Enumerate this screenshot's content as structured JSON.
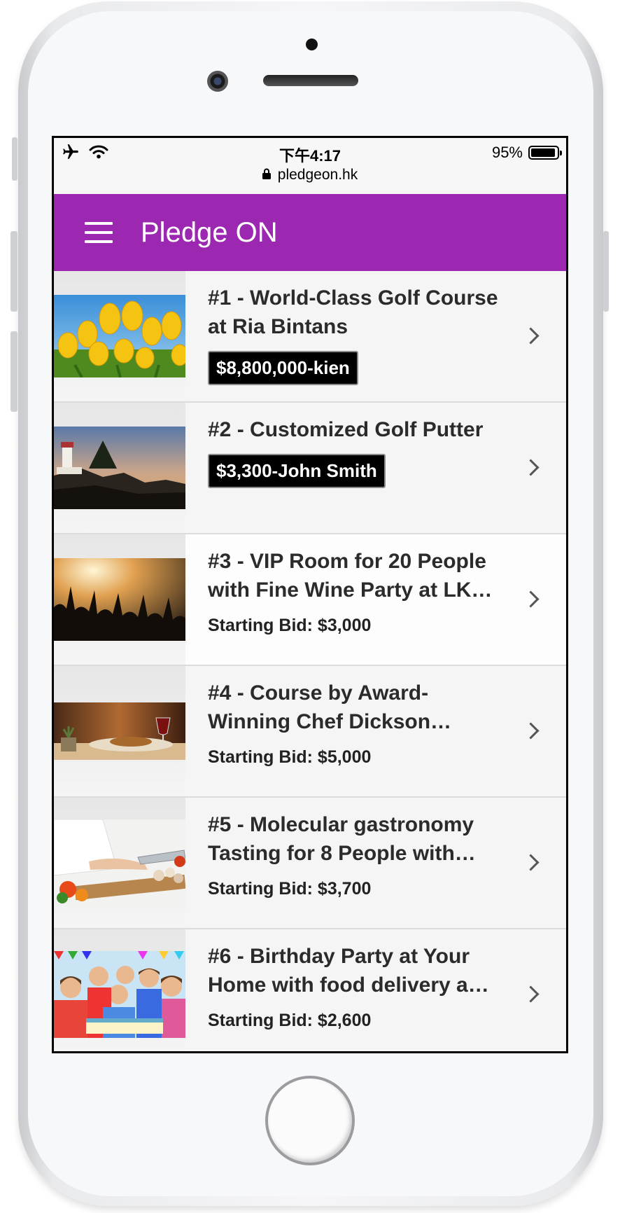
{
  "status": {
    "time": "下午4:17",
    "url": "pledgeon.hk",
    "battery_text": "95%",
    "battery_level": 0.95
  },
  "app": {
    "title": "Pledge ON",
    "accent": "#9c27b0"
  },
  "items": [
    {
      "title": "#1 - World-Class Golf Course at Ria Bintans",
      "bid": "$8,800,000-kien",
      "bid_type": "badge"
    },
    {
      "title": "#2 - Customized Golf Putter",
      "bid": "$3,300-John Smith",
      "bid_type": "badge"
    },
    {
      "title": "#3 - VIP Room for 20 People with Fine Wine Party at LK…",
      "bid": "Starting Bid: $3,000",
      "bid_type": "text"
    },
    {
      "title": "#4 - Course by Award-Winning Chef Dickson…",
      "bid": "Starting Bid: $5,000",
      "bid_type": "text"
    },
    {
      "title": "#5 - Molecular gastronomy Tasting for 8 People with…",
      "bid": "Starting Bid: $3,700",
      "bid_type": "text"
    },
    {
      "title": "#6 - Birthday Party at Your Home with food delivery a…",
      "bid": "Starting Bid: $2,600",
      "bid_type": "text"
    }
  ],
  "icons": {
    "airplane": "airplane-icon",
    "wifi": "wifi-icon",
    "lock": "lock-icon",
    "battery": "battery-icon",
    "menu": "hamburger-menu-icon",
    "chevron": "chevron-right-icon"
  }
}
